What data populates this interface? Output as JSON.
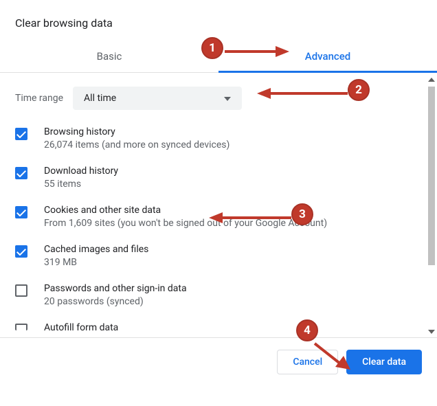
{
  "dialog": {
    "title": "Clear browsing data"
  },
  "tabs": {
    "basic": "Basic",
    "advanced": "Advanced"
  },
  "timerange": {
    "label": "Time range",
    "value": "All time"
  },
  "items": [
    {
      "title": "Browsing history",
      "sub": "26,074 items (and more on synced devices)",
      "checked": true
    },
    {
      "title": "Download history",
      "sub": "55 items",
      "checked": true
    },
    {
      "title": "Cookies and other site data",
      "sub": "From 1,609 sites (you won't be signed out of your Google Account)",
      "checked": true
    },
    {
      "title": "Cached images and files",
      "sub": "319 MB",
      "checked": true
    },
    {
      "title": "Passwords and other sign-in data",
      "sub": "20 passwords (synced)",
      "checked": false
    },
    {
      "title": "Autofill form data",
      "sub": "",
      "checked": false
    }
  ],
  "footer": {
    "cancel": "Cancel",
    "clear": "Clear data"
  },
  "annotations": {
    "b1": "1",
    "b2": "2",
    "b3": "3",
    "b4": "4"
  }
}
